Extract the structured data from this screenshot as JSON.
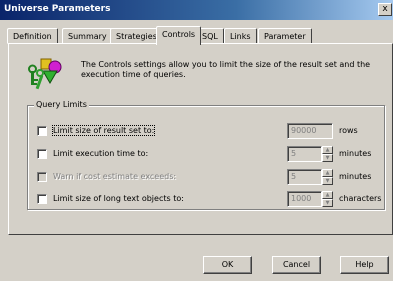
{
  "window": {
    "title": "Universe Parameters",
    "close_glyph": "x"
  },
  "tabs": [
    "Definition",
    "Summary",
    "Strategies",
    "Controls",
    "SQL",
    "Links",
    "Parameter"
  ],
  "active_tab": "Controls",
  "intro_text": "The Controls settings allow you to limit the size of the result set and the execution time of queries.",
  "icon": "controls-shapes-icon",
  "query_limits": {
    "group_label": "Query Limits",
    "rows": [
      {
        "label": "Limit size of result set to:",
        "value": "90000",
        "unit": "rows",
        "enabled": true,
        "checked": false,
        "spinner": false
      },
      {
        "label": "Limit execution time to:",
        "value": "5",
        "unit": "minutes",
        "enabled": true,
        "checked": false,
        "spinner": true
      },
      {
        "label": "Warn if cost estimate exceeds:",
        "value": "5",
        "unit": "minutes",
        "enabled": false,
        "checked": false,
        "spinner": true
      },
      {
        "label": "Limit size of long text objects to:",
        "value": "1000",
        "unit": "characters",
        "enabled": true,
        "checked": false,
        "spinner": true
      }
    ]
  },
  "buttons": {
    "ok": "OK",
    "cancel": "Cancel",
    "help": "Help"
  },
  "colors": {
    "face": "#d4d0c8",
    "title_start": "#0a246a",
    "title_end": "#a6caf0"
  }
}
